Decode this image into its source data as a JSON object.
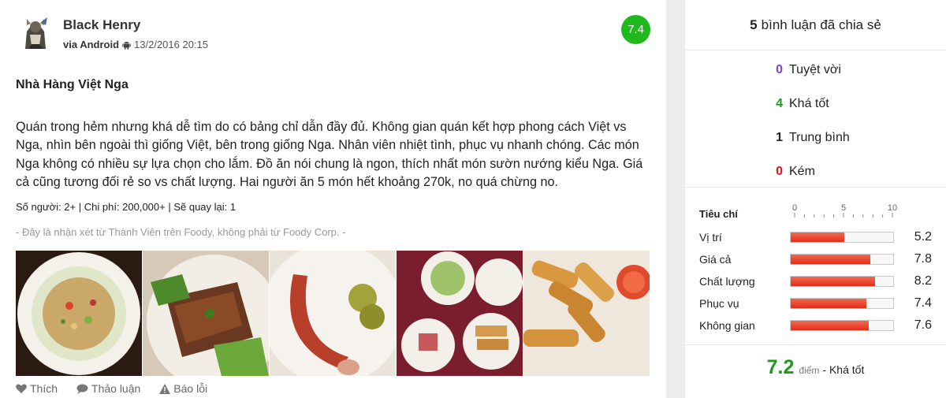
{
  "review": {
    "author": "Black Henry",
    "via": "via Android",
    "timestamp": "13/2/2016 20:15",
    "score": "7.4",
    "title": "Nhà Hàng Việt Nga",
    "body": "Quán trong hẻm nhưng khá dễ tìm do có bảng chỉ dẫn đầy đủ. Không gian quán kết hợp phong cách Việt vs Nga, nhìn bên ngoài thì giống Việt, bên trong giống Nga. Nhân viên nhiệt tình, phục vụ nhanh chóng. Các món Nga không có nhiều sự lựa chọn cho lắm. Đồ ăn nói chung là ngon, thích nhất món sườn nướng kiểu Nga. Giá cả cũng tương đối rẻ so vs chất lượng. Hai người ăn 5 món hết khoảng 270k, no quá chừng no.",
    "stats": "Số người: 2+ | Chi phí: 200,000+ | Sẽ quay lại: 1",
    "disclaimer": "- Đây là nhận xét từ Thành Viên trên Foody, không phải từ Foody Corp. -",
    "photos": [
      "fried-rice",
      "grilled-ribs",
      "sausage-pickles",
      "salad-spread",
      "spring-rolls"
    ],
    "actions": {
      "like": "Thích",
      "discuss": "Thảo luận",
      "report": "Báo lỗi"
    },
    "icons": {
      "like": "heart-icon",
      "discuss": "comment-icon",
      "report": "warning-icon",
      "platform": "android-icon"
    },
    "colors": {
      "score_badge": "#1fb81d"
    }
  },
  "sidebar": {
    "header_count": "5",
    "header_text": "bình luận đã chia sẻ",
    "counts": [
      {
        "num": "0",
        "label": "Tuyệt vời",
        "color": "#8b3fc4"
      },
      {
        "num": "4",
        "label": "Khá tốt",
        "color": "#1d9a1a"
      },
      {
        "num": "1",
        "label": "Trung bình",
        "color": "#222222"
      },
      {
        "num": "0",
        "label": "Kém",
        "color": "#d21c1c"
      }
    ],
    "criteria_title": "Tiêu chí",
    "scale_labels": [
      "0",
      "5",
      "10"
    ],
    "criteria": [
      {
        "label": "Vị trí",
        "value": "5.2",
        "score": 5.2
      },
      {
        "label": "Giá cả",
        "value": "7.8",
        "score": 7.8
      },
      {
        "label": "Chất lượng",
        "value": "8.2",
        "score": 8.2
      },
      {
        "label": "Phục vụ",
        "value": "7.4",
        "score": 7.4
      },
      {
        "label": "Không gian",
        "value": "7.6",
        "score": 7.6
      }
    ],
    "overall_score": "7.2",
    "overall_unit": "điểm",
    "overall_desc": "- Khá tốt"
  }
}
